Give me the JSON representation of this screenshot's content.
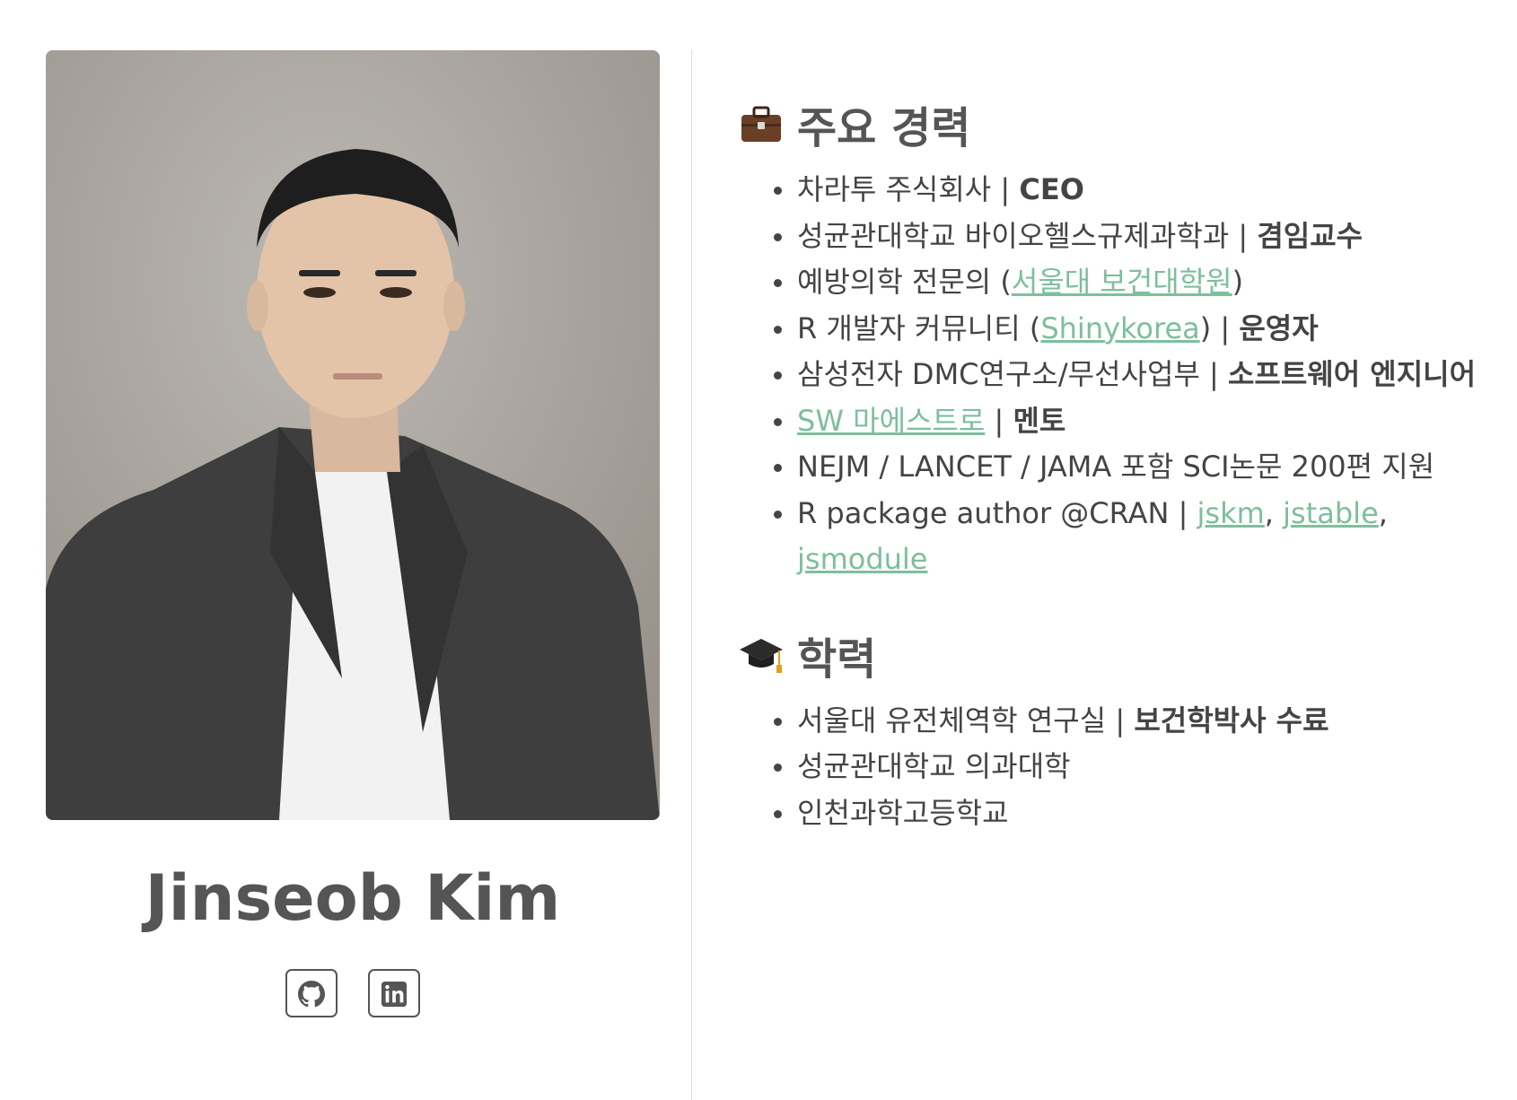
{
  "profile": {
    "name": "Jinseob Kim",
    "photo_alt": "Jinseob Kim",
    "social": [
      {
        "label": "GitHub",
        "icon": "github-icon"
      },
      {
        "label": "LinkedIn",
        "icon": "linkedin-icon"
      }
    ]
  },
  "career": {
    "emoji": "briefcase-icon",
    "title": "주요 경력",
    "items": [
      {
        "parts": [
          {
            "t": "차라투 주식회사 | "
          },
          {
            "t": "CEO",
            "b": true
          }
        ]
      },
      {
        "parts": [
          {
            "t": "성균관대학교 바이오헬스규제과학과 | "
          },
          {
            "t": "겸임교수",
            "b": true
          }
        ]
      },
      {
        "parts": [
          {
            "t": "예방의학 전문의 ("
          },
          {
            "t": "서울대 보건대학원",
            "link": true
          },
          {
            "t": ")"
          }
        ]
      },
      {
        "parts": [
          {
            "t": "R 개발자 커뮤니티 ("
          },
          {
            "t": "Shinykorea",
            "link": true
          },
          {
            "t": ") | "
          },
          {
            "t": "운영자",
            "b": true
          }
        ]
      },
      {
        "parts": [
          {
            "t": "삼성전자 DMC연구소/무선사업부 | "
          },
          {
            "t": "소프트웨어 엔지니어",
            "b": true
          }
        ]
      },
      {
        "parts": [
          {
            "t": "SW 마에스트로",
            "link": true
          },
          {
            "t": " | "
          },
          {
            "t": "멘토",
            "b": true
          }
        ]
      },
      {
        "parts": [
          {
            "t": "NEJM / LANCET / JAMA 포함 SCI논문 200편 지원"
          }
        ]
      },
      {
        "parts": [
          {
            "t": "R package author @CRAN | "
          },
          {
            "t": "jskm",
            "link": true
          },
          {
            "t": ", "
          },
          {
            "t": "jstable",
            "link": true
          },
          {
            "t": ", "
          },
          {
            "t": "jsmodule",
            "link": true
          }
        ]
      }
    ]
  },
  "education": {
    "emoji": "graduation-cap-icon",
    "title": "학력",
    "items": [
      {
        "parts": [
          {
            "t": "서울대 유전체역학 연구실 | "
          },
          {
            "t": "보건학박사 수료",
            "b": true
          }
        ]
      },
      {
        "parts": [
          {
            "t": "성균관대학교 의과대학"
          }
        ]
      },
      {
        "parts": [
          {
            "t": "인천과학고등학교"
          }
        ]
      }
    ]
  },
  "colors": {
    "link": "#7dbf9c",
    "text": "#444444",
    "divider": "#dddddd"
  }
}
